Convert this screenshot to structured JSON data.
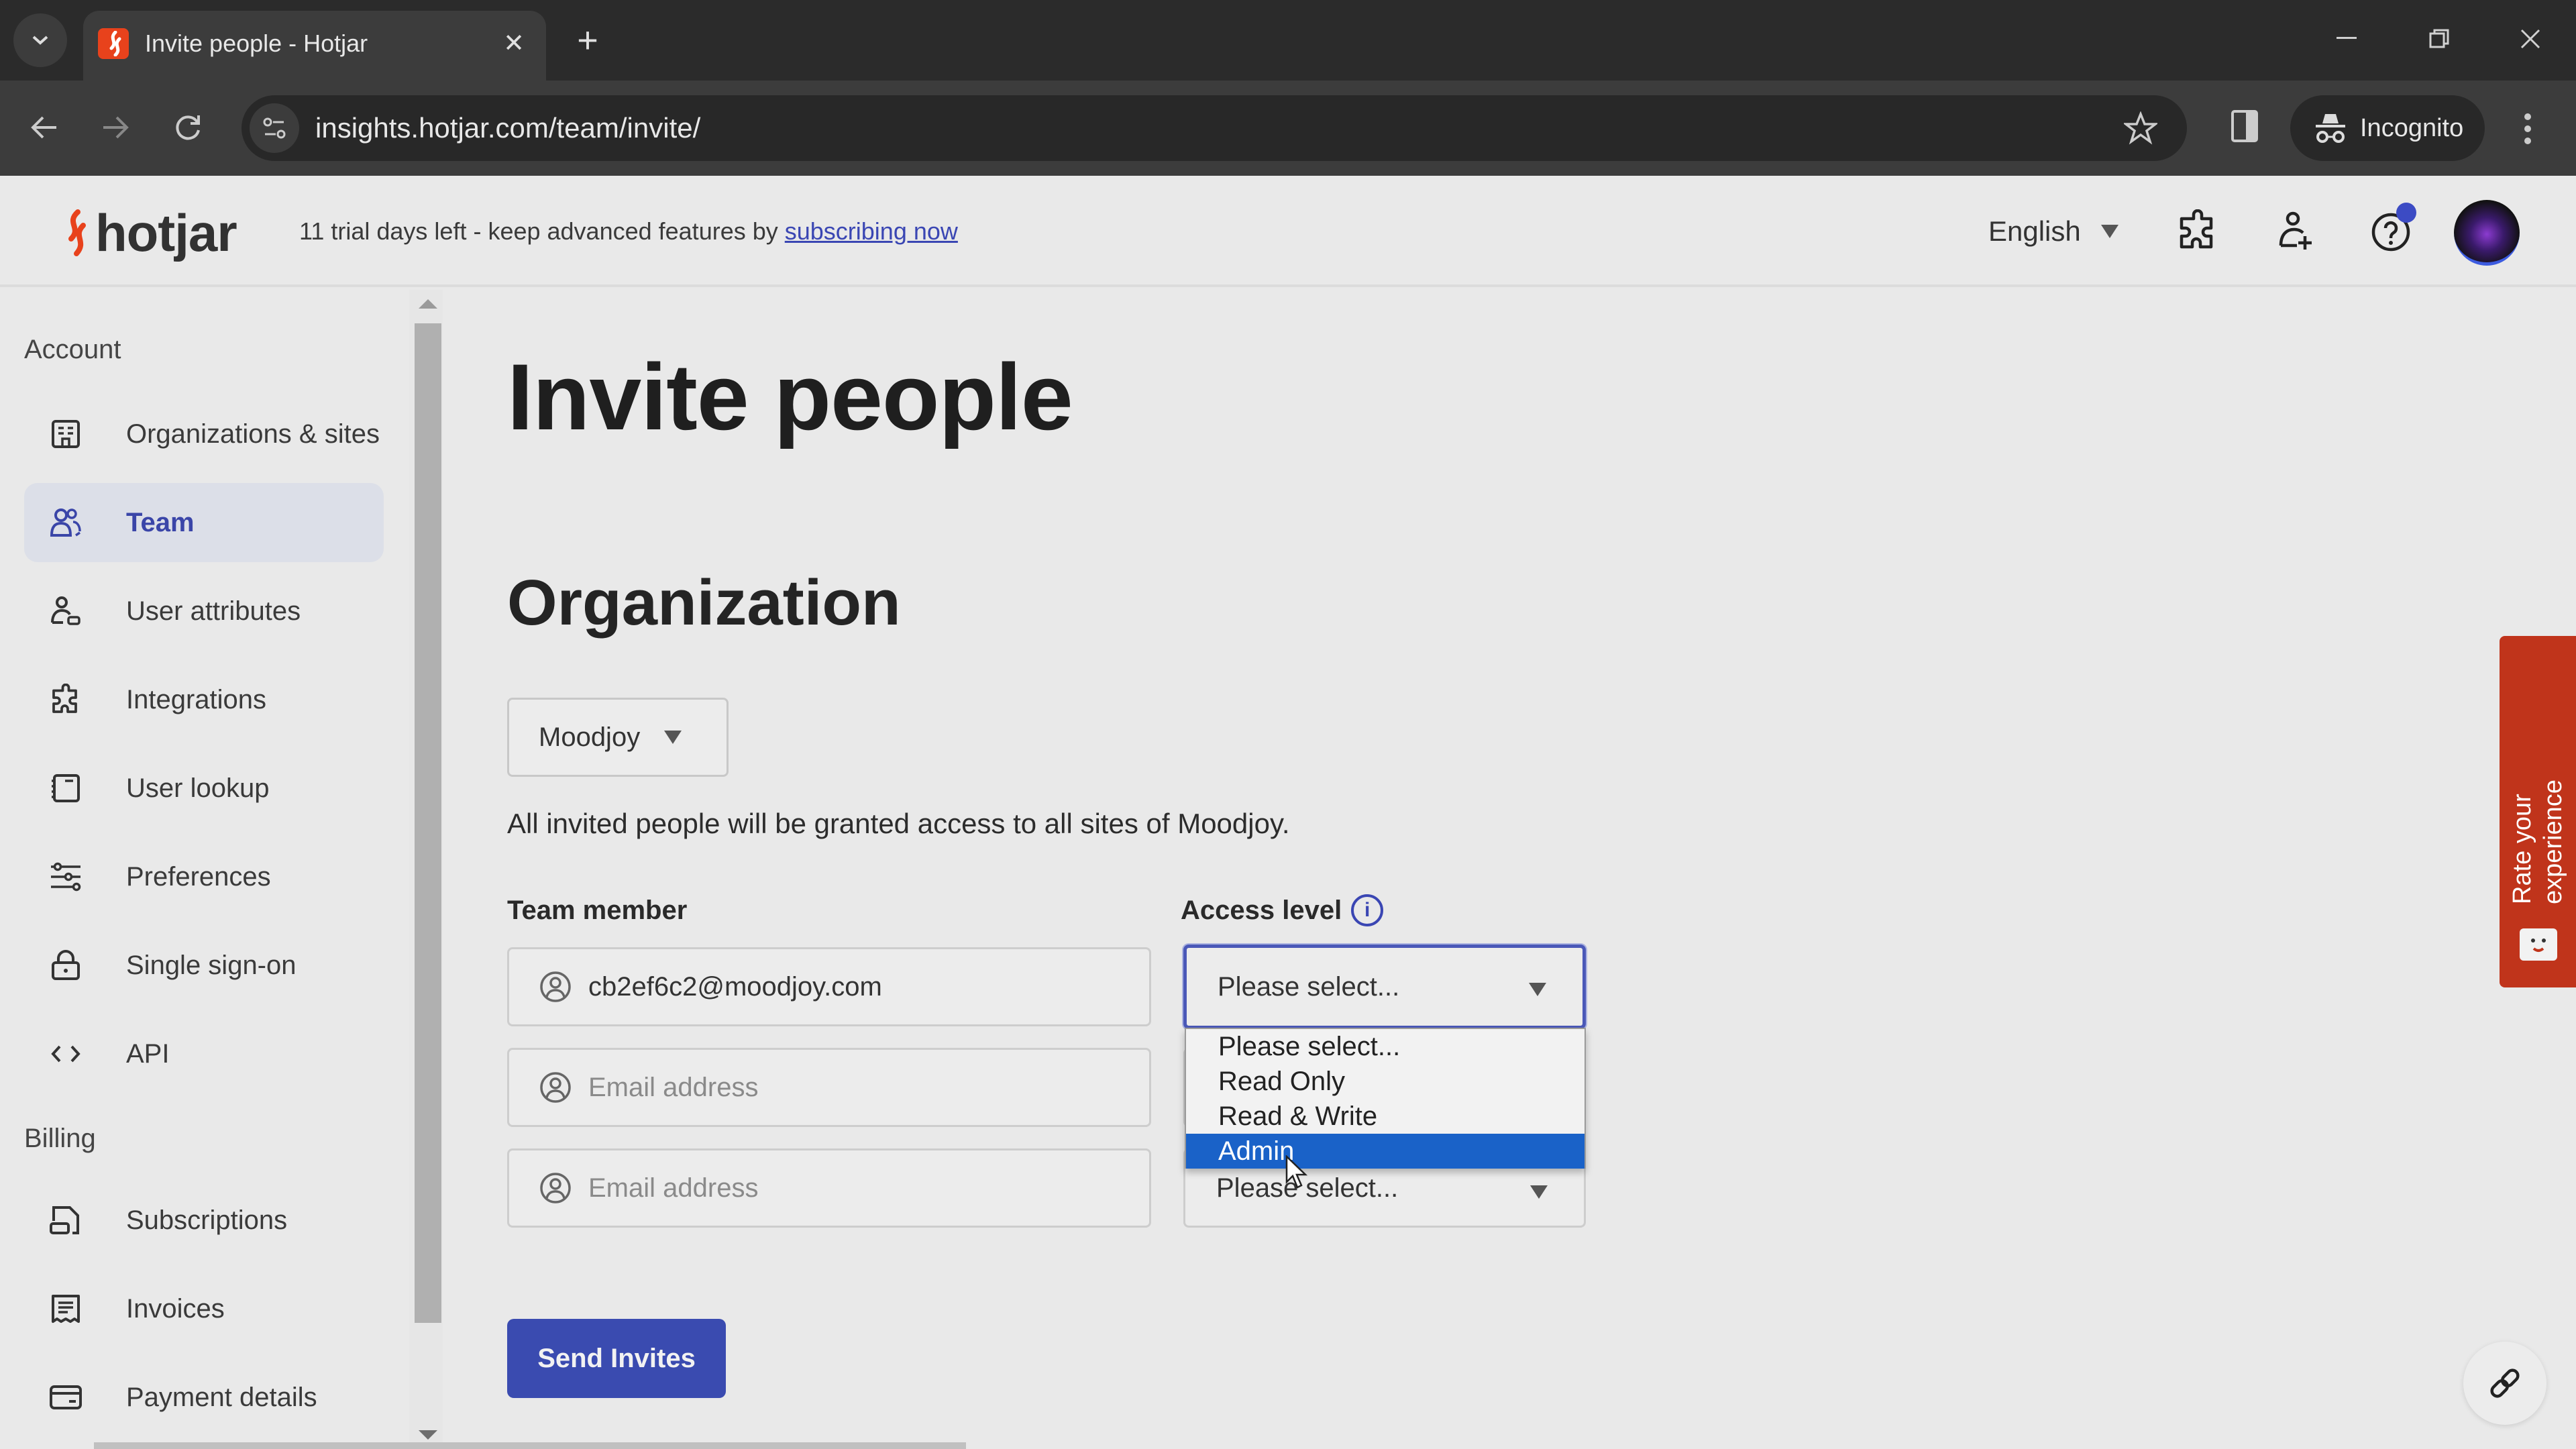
{
  "browser": {
    "tab_title": "Invite people - Hotjar",
    "url": "insights.hotjar.com/team/invite/",
    "incognito_label": "Incognito"
  },
  "header": {
    "brand": "hotjar",
    "trial_text": "11 trial days left - keep advanced features by ",
    "trial_link": "subscribing now",
    "language": "English",
    "help_notification": true
  },
  "sidebar": {
    "sections": [
      {
        "heading": "Account",
        "items": [
          {
            "label": "Organizations & sites",
            "icon": "building-icon"
          },
          {
            "label": "Team",
            "icon": "team-icon",
            "active": true
          },
          {
            "label": "User attributes",
            "icon": "user-attributes-icon"
          },
          {
            "label": "Integrations",
            "icon": "puzzle-icon"
          },
          {
            "label": "User lookup",
            "icon": "notebook-icon"
          },
          {
            "label": "Preferences",
            "icon": "sliders-icon"
          },
          {
            "label": "Single sign-on",
            "icon": "lock-icon"
          },
          {
            "label": "API",
            "icon": "code-icon"
          }
        ]
      },
      {
        "heading": "Billing",
        "items": [
          {
            "label": "Subscriptions",
            "icon": "subscription-icon"
          },
          {
            "label": "Invoices",
            "icon": "receipt-icon"
          },
          {
            "label": "Payment details",
            "icon": "credit-card-icon"
          }
        ]
      }
    ]
  },
  "main": {
    "title": "Invite people",
    "section_title": "Organization",
    "organization": "Moodjoy",
    "note": "All invited people will be granted access to all sites of Moodjoy.",
    "team_member_label": "Team member",
    "access_level_label": "Access level",
    "rows": [
      {
        "email": "cb2ef6c2@moodjoy.com",
        "placeholder": "Email address",
        "access": "Please select..."
      },
      {
        "email": "",
        "placeholder": "Email address",
        "access": "Please select..."
      },
      {
        "email": "",
        "placeholder": "Email address",
        "access": "Please select..."
      }
    ],
    "dropdown_options": [
      "Please select...",
      "Read Only",
      "Read & Write",
      "Admin"
    ],
    "dropdown_highlighted": "Admin",
    "send_button": "Send Invites"
  },
  "feedback": {
    "rate_label": "Rate your experience"
  },
  "colors": {
    "brand_orange": "#e8421c",
    "primary_blue": "#3a4bb0",
    "active_nav_text": "#3a45a8",
    "dropdown_highlight": "#1a62c8",
    "feedback_red": "#c0341b"
  }
}
